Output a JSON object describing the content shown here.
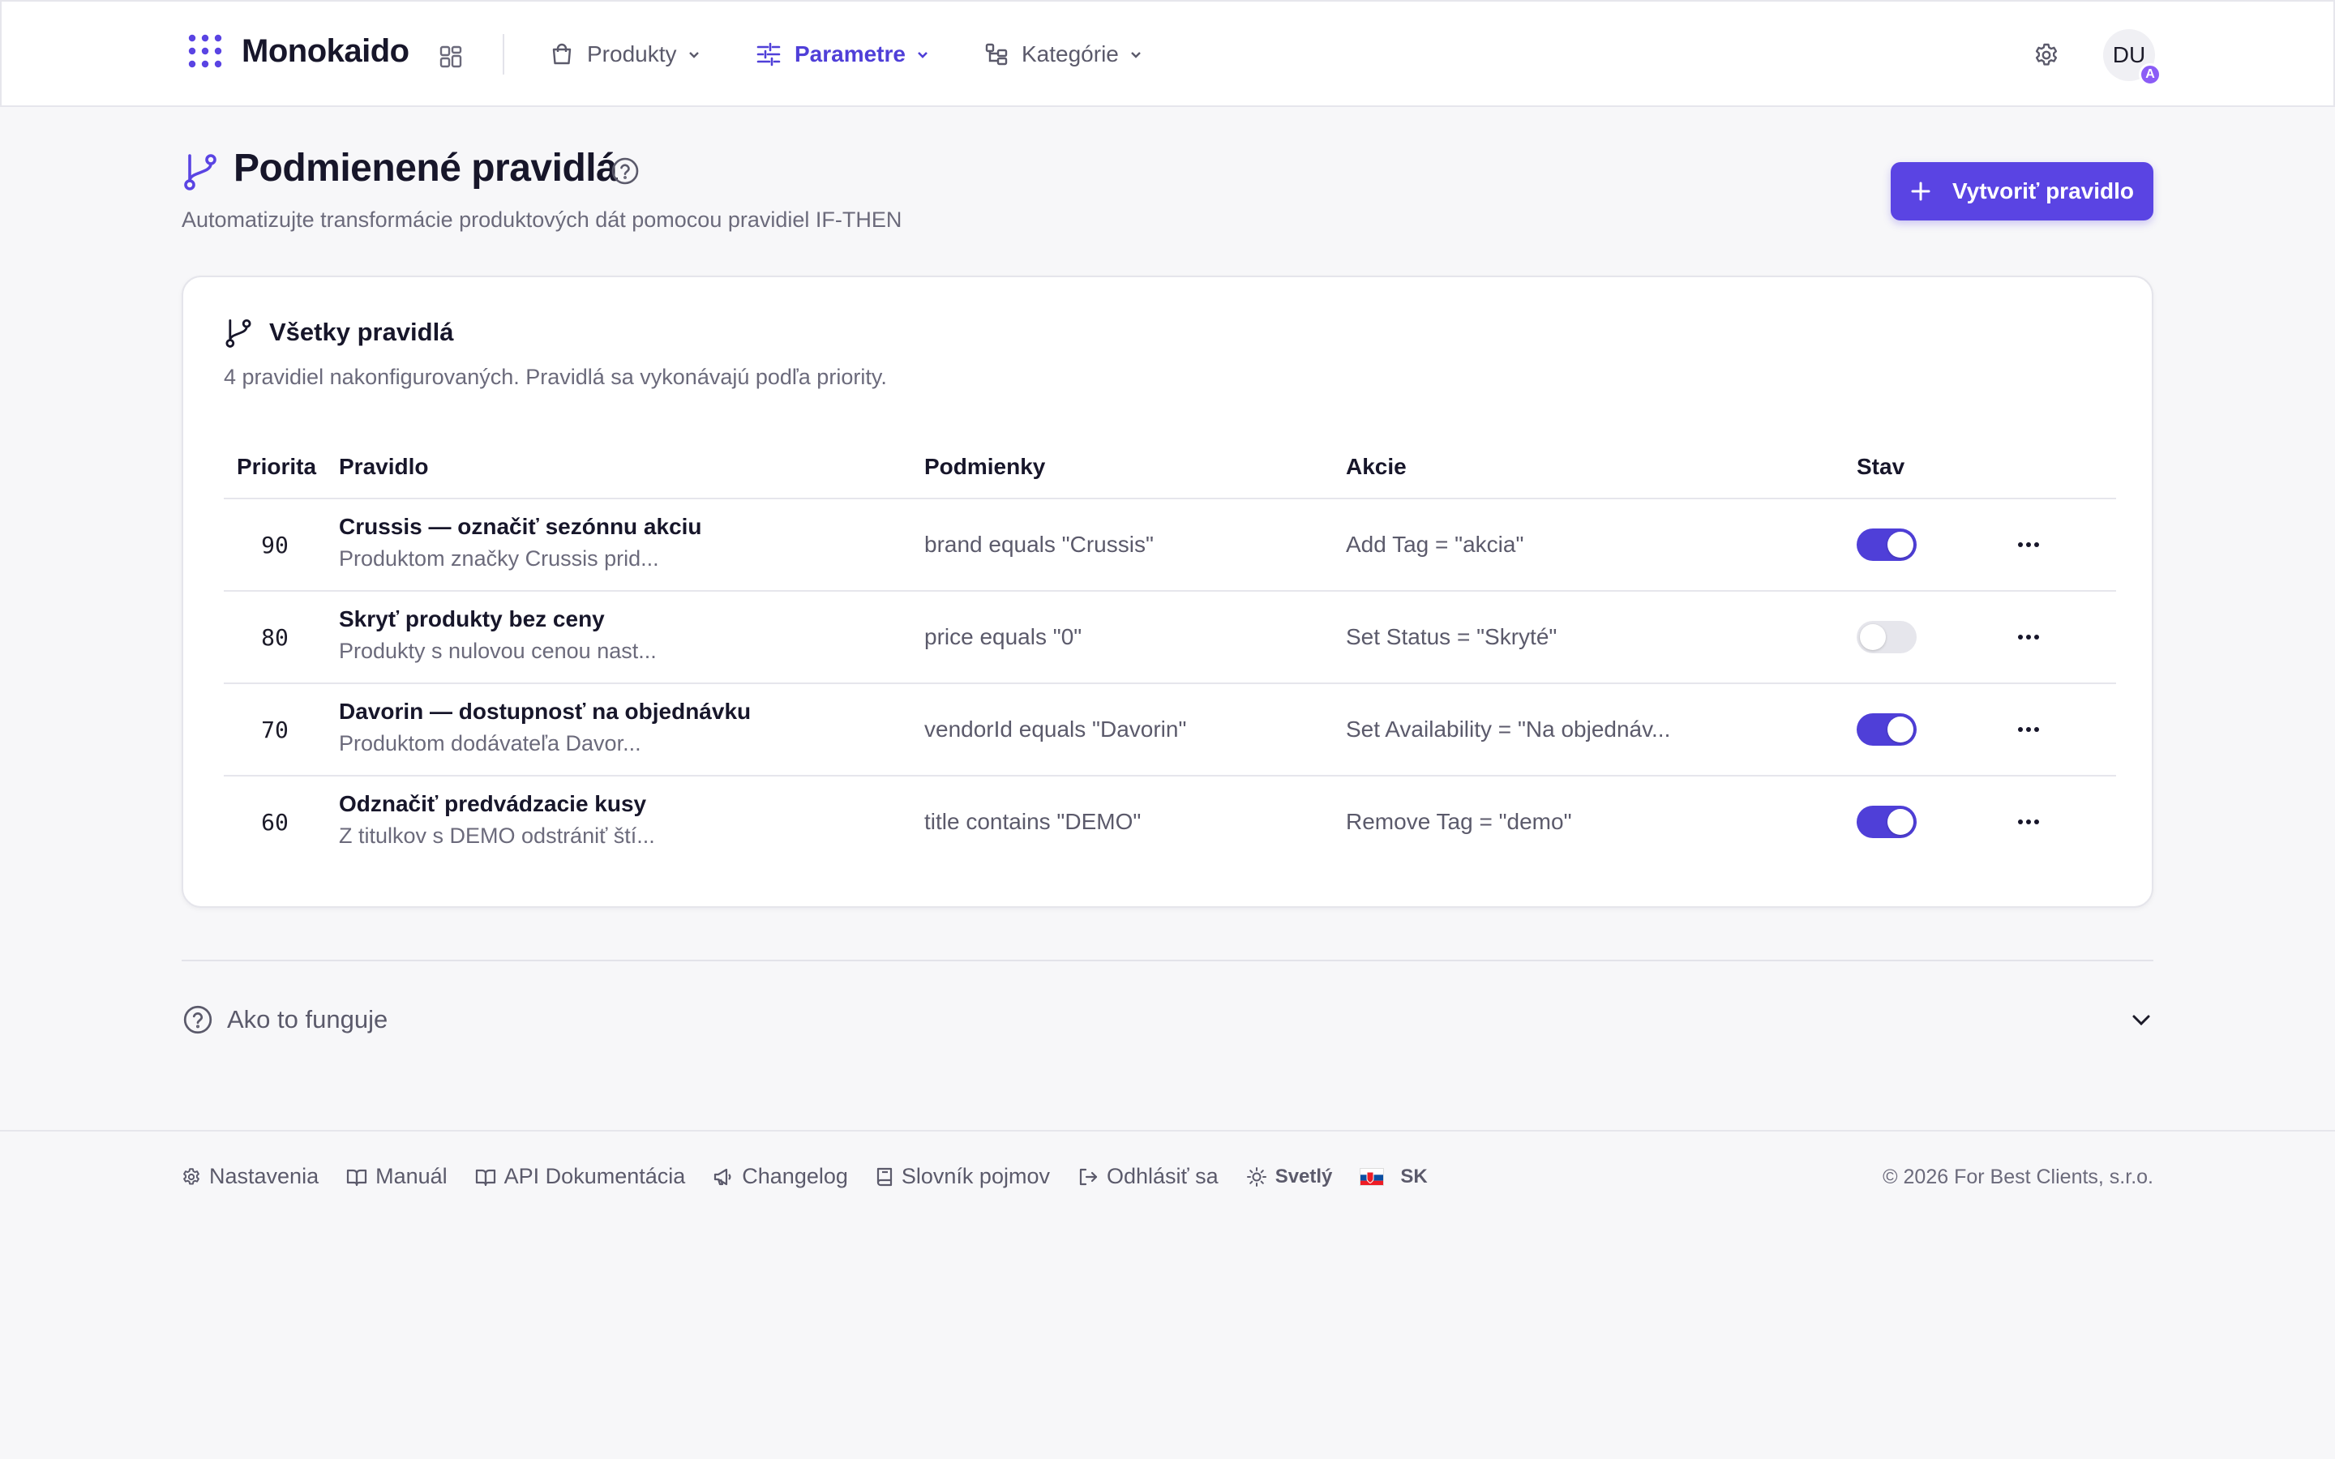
{
  "nav": {
    "brand": "Monokaido",
    "items": [
      {
        "label": "Produkty",
        "active": false
      },
      {
        "label": "Parametre",
        "active": true
      },
      {
        "label": "Kategórie",
        "active": false
      }
    ],
    "avatar_initials": "DU",
    "avatar_badge": "A"
  },
  "page": {
    "title": "Podmienené pravidlá",
    "subtitle": "Automatizujte transformácie produktových dát pomocou pravidiel IF-THEN",
    "create_button": "Vytvoriť pravidlo"
  },
  "card": {
    "title": "Všetky pravidlá",
    "subtitle": "4 pravidiel nakonfigurovaných. Pravidlá sa vykonávajú podľa priority.",
    "columns": [
      "Priorita",
      "Pravidlo",
      "Podmienky",
      "Akcie",
      "Stav"
    ],
    "rules": [
      {
        "priority": "90",
        "name": "Crussis — označiť sezónnu akciu",
        "description": "Produktom značky Crussis prid...",
        "condition": "brand equals \"Crussis\"",
        "action": "Add Tag = \"akcia\"",
        "enabled": true
      },
      {
        "priority": "80",
        "name": "Skryť produkty bez ceny",
        "description": "Produkty s nulovou cenou nast...",
        "condition": "price equals \"0\"",
        "action": "Set Status = \"Skryté\"",
        "enabled": false
      },
      {
        "priority": "70",
        "name": "Davorin — dostupnosť na objednávku",
        "description": "Produktom dodávateľa Davor...",
        "condition": "vendorId equals \"Davorin\"",
        "action": "Set Availability = \"Na objednáv...",
        "enabled": true
      },
      {
        "priority": "60",
        "name": "Odznačiť predvádzacie kusy",
        "description": "Z titulkov s DEMO odstrániť ští...",
        "condition": "title contains \"DEMO\"",
        "action": "Remove Tag = \"demo\"",
        "enabled": true
      }
    ]
  },
  "accordion": {
    "label": "Ako to funguje"
  },
  "footer": {
    "links": {
      "settings": "Nastavenia",
      "manual": "Manuál",
      "api": "API Dokumentácia",
      "changelog": "Changelog",
      "glossary": "Slovník pojmov",
      "logout": "Odhlásiť sa",
      "theme": "Svetlý",
      "language": "SK"
    },
    "copyright": "© 2026 For Best Clients, s.r.o."
  },
  "colors": {
    "accent": "#5a44e3",
    "accent_active": "#4f3fd8",
    "badge": "#8b5cf6"
  }
}
